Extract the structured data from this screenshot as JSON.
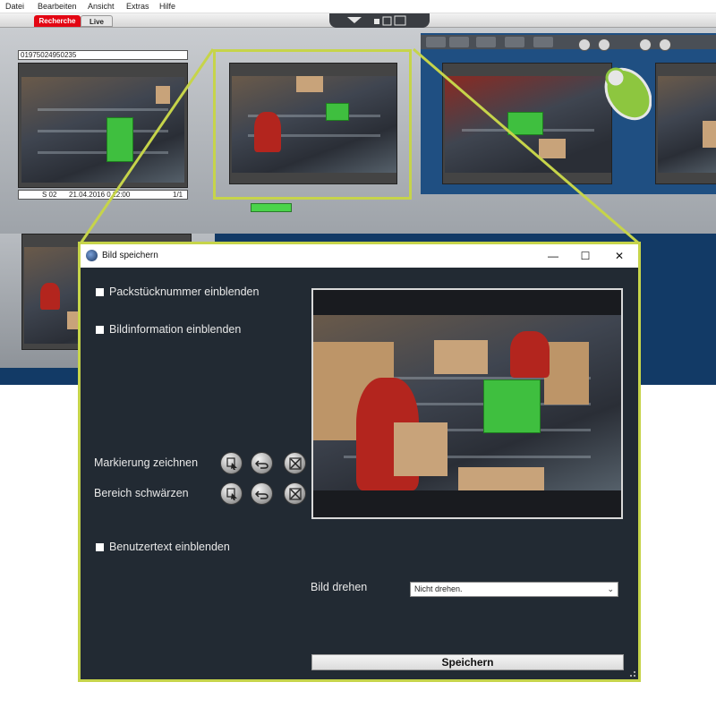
{
  "menu": {
    "items": [
      "Datei",
      "Bearbeiten",
      "Ansicht",
      "Extras",
      "Hilfe"
    ]
  },
  "app_tabs": {
    "recherche": "Recherche",
    "live": "Live"
  },
  "camera_panel": {
    "id_number": "01975024950235",
    "station": "S 02",
    "datetime": "21.04.2016 0 12:00",
    "counter": "1/1"
  },
  "dialog": {
    "title": "Bild speichern",
    "checkbox_package_number": "Packstücknummer einblenden",
    "checkbox_image_info": "Bildinformation einblenden",
    "label_draw_marking": "Markierung zeichnen",
    "label_blacken_area": "Bereich schwärzen",
    "checkbox_user_text": "Benutzertext einblenden",
    "label_rotate": "Bild drehen",
    "rotate_selected": "Nicht drehen.",
    "save_button": "Speichern",
    "minimize_glyph": "—",
    "maximize_glyph": "☐",
    "close_glyph": "✕"
  },
  "colors": {
    "app_blue": "#123a66",
    "dialog_bg": "#222a33",
    "highlight": "#c6d44a",
    "tab_red": "#e30613"
  }
}
